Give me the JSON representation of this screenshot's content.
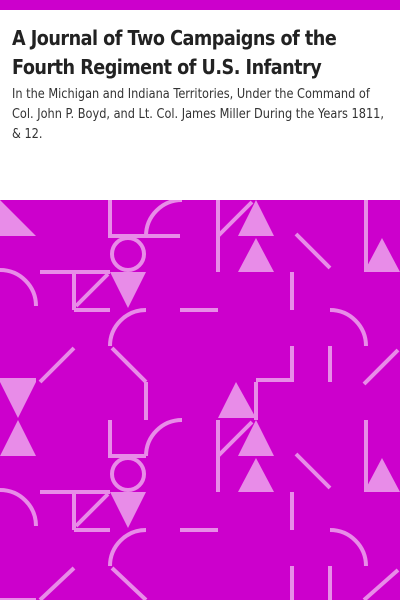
{
  "book": {
    "title": "A Journal of Two Campaigns of the Fourth Regiment of U.S. Infantry",
    "subtitle": "In the Michigan and Indiana Territories, Under the Command of Col. John P. Boyd, and Lt. Col. James Miller During the Years 1811, & 12."
  },
  "colors": {
    "accent": "#cc00cc",
    "motif": "#e88ce8",
    "background": "#ffffff",
    "title_text": "#222222",
    "subtitle_text": "#333333"
  }
}
